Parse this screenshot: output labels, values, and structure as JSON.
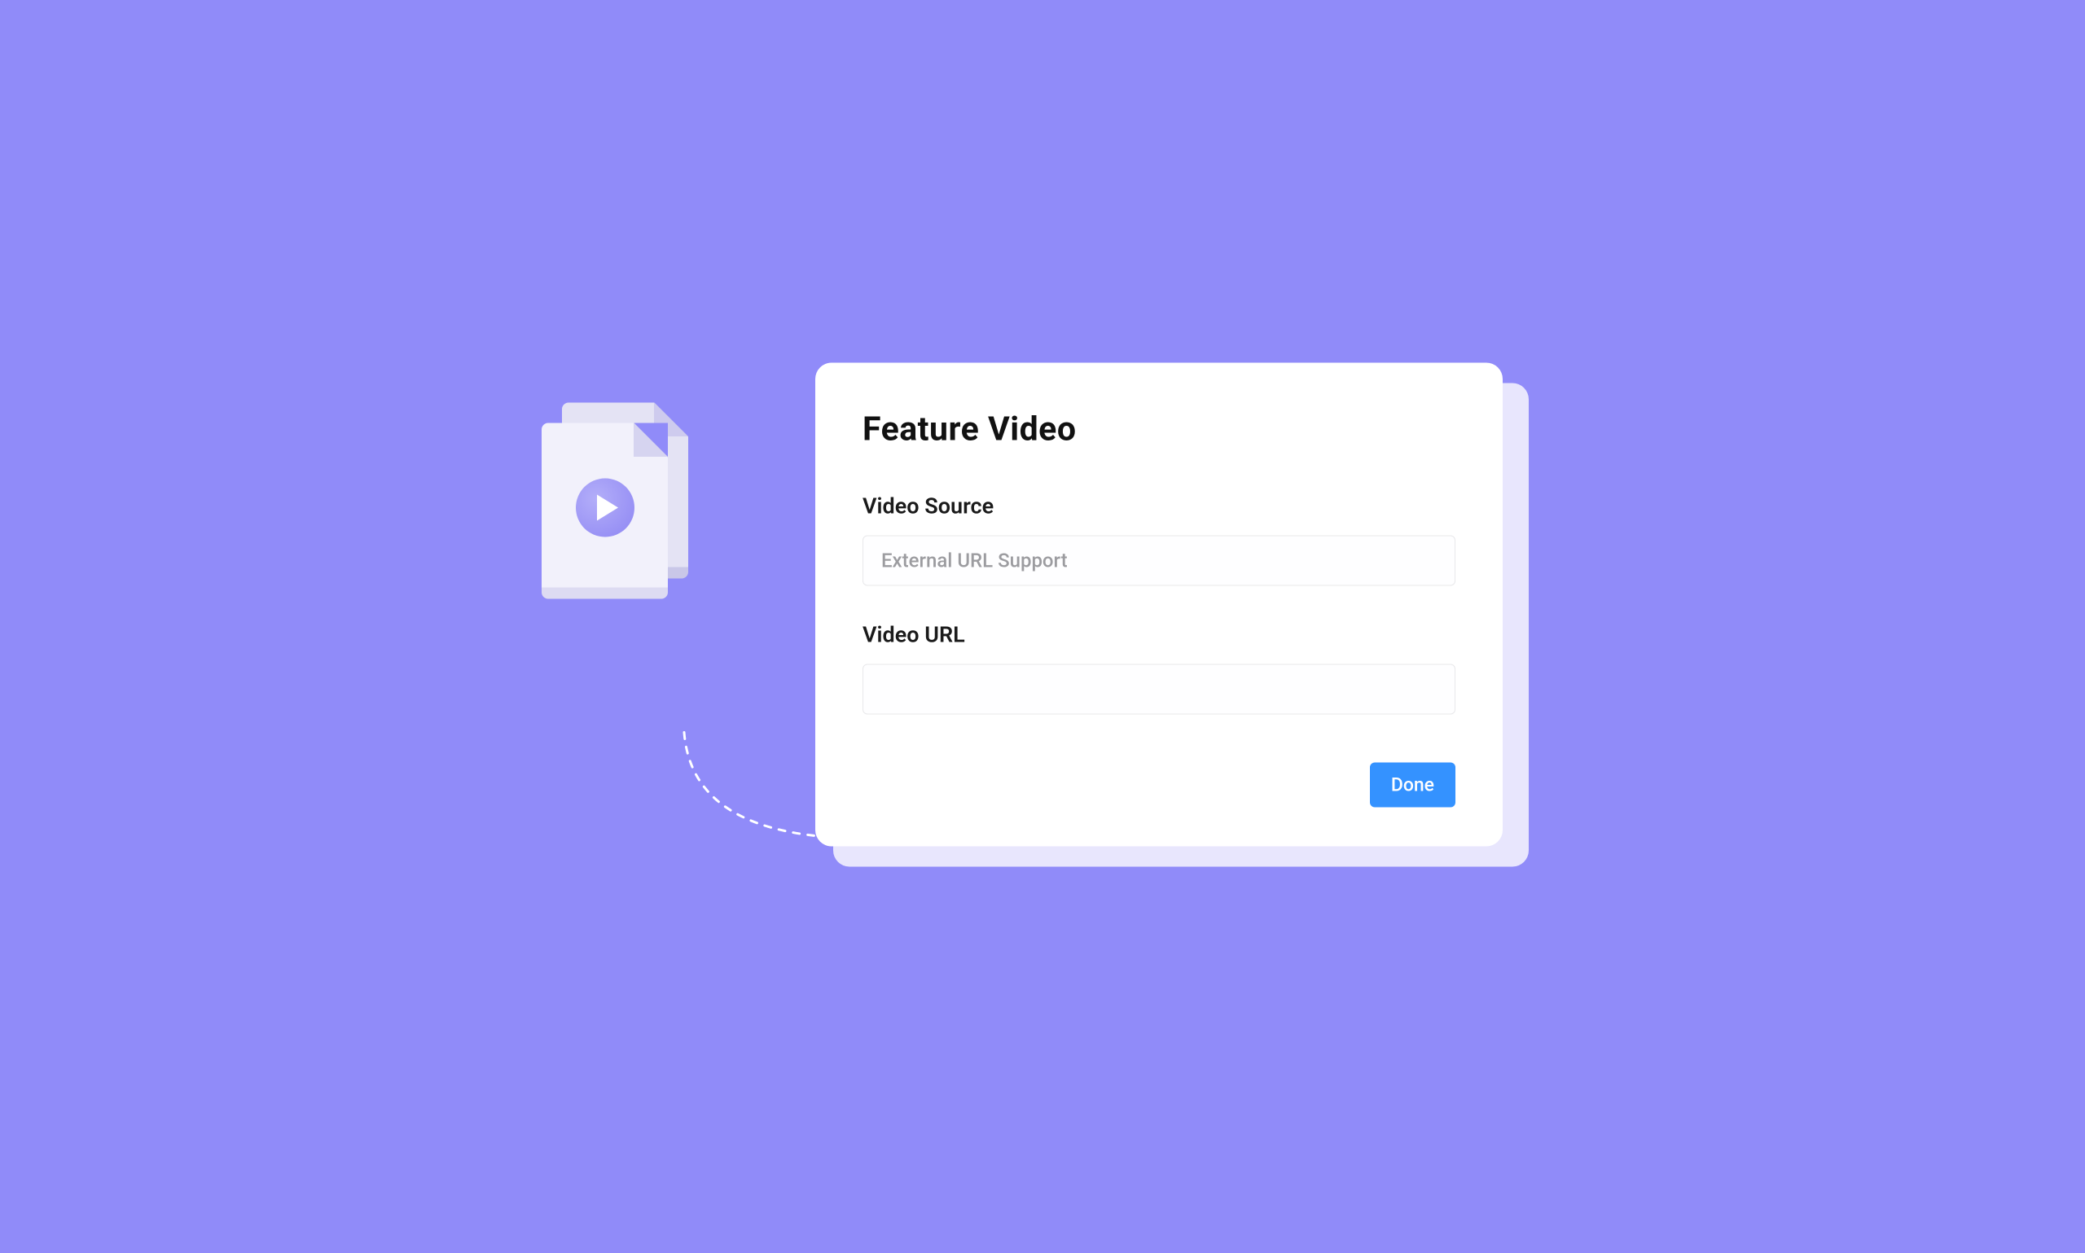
{
  "card": {
    "title": "Feature Video",
    "fields": {
      "video_source": {
        "label": "Video Source",
        "placeholder": "External URL Support",
        "value": ""
      },
      "video_url": {
        "label": "Video URL",
        "placeholder": "",
        "value": ""
      }
    },
    "actions": {
      "done_label": "Done"
    }
  },
  "illustration": {
    "icon": "video-file-icon"
  }
}
